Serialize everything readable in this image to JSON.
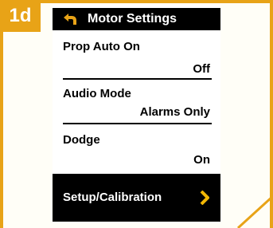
{
  "step": {
    "label": "1d"
  },
  "screen": {
    "title": "Motor Settings",
    "back_icon": "back-arrow-icon",
    "rows": [
      {
        "label": "Prop Auto On",
        "value": "Off"
      },
      {
        "label": "Audio Mode",
        "value": "Alarms Only"
      },
      {
        "label": "Dodge",
        "value": "On"
      }
    ],
    "cta": {
      "label": "Setup/Calibration",
      "icon": "chevron-right-icon"
    }
  },
  "colors": {
    "accent": "#e8a317",
    "screen_bg": "#ffffff",
    "bar": "#000000",
    "chevron": "#f2b705"
  }
}
